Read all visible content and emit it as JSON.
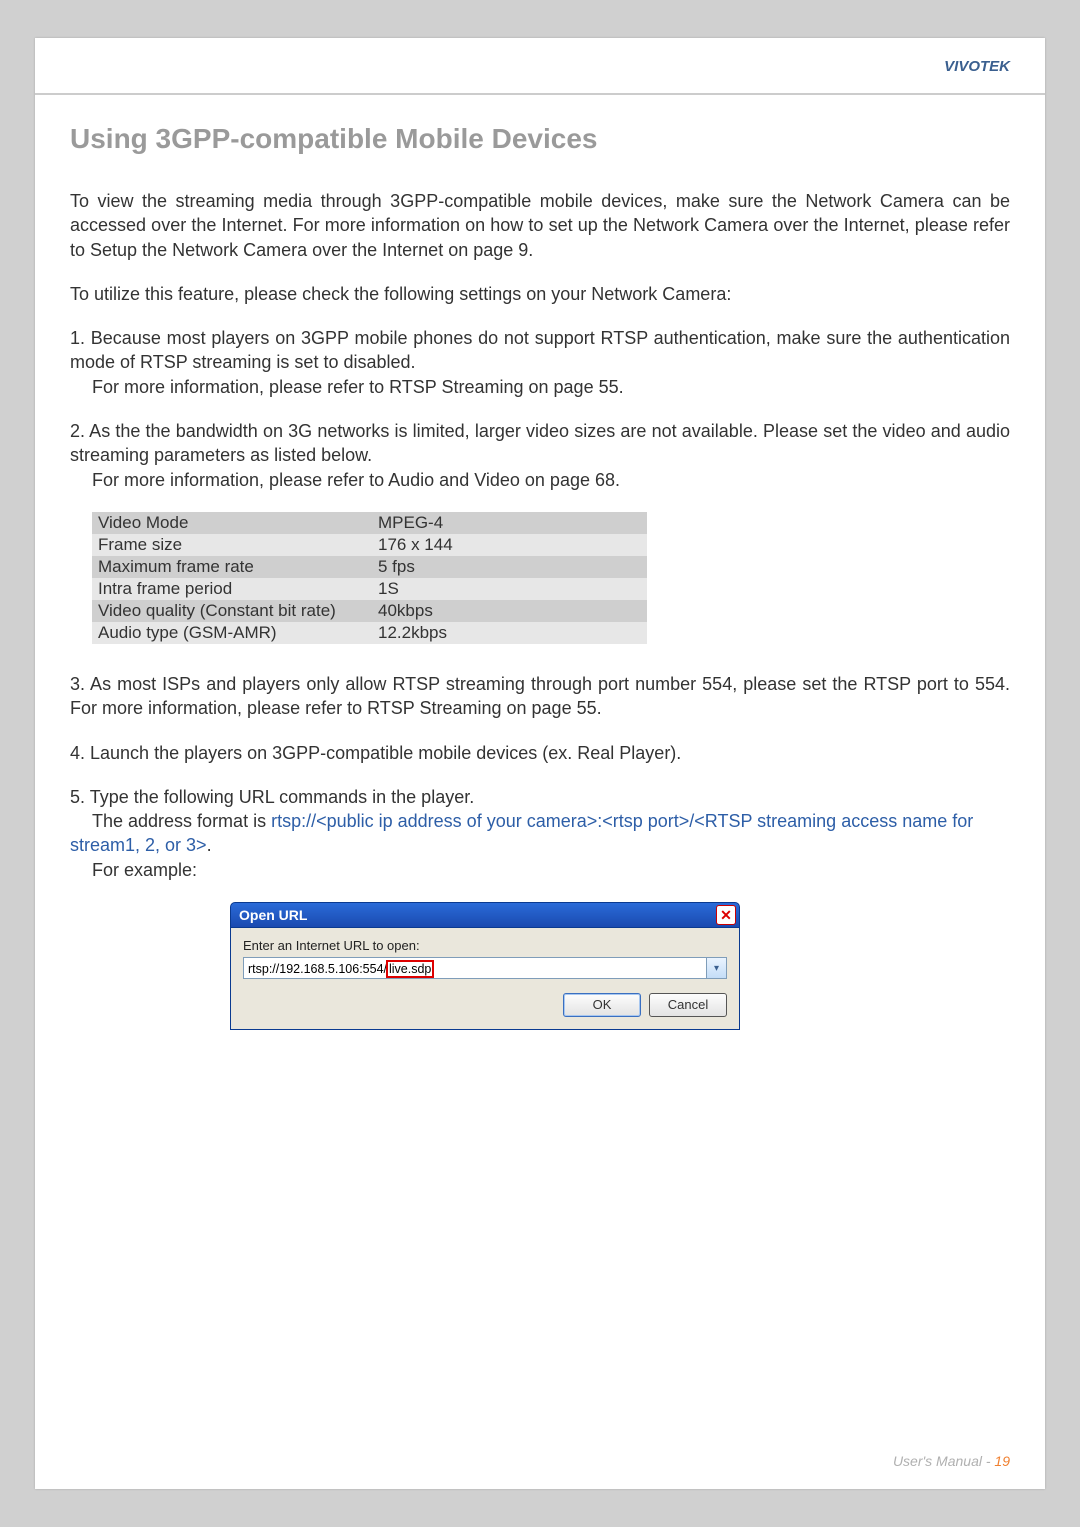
{
  "brand": "VIVOTEK",
  "section_title": "Using 3GPP-compatible Mobile Devices",
  "intro": "To view the streaming media through 3GPP-compatible mobile devices, make sure the Network Camera can be accessed over the Internet. For more information on how to set up the Network Camera over the Internet, please refer to Setup the Network Camera over the Internet on page 9.",
  "lead": "To utilize this feature, please check the following settings on your Network Camera:",
  "item1_a": "1. Because most players on 3GPP mobile phones do not support RTSP authentication, make sure the authentication mode of RTSP streaming is set to disabled.",
  "item1_b": "For more information, please refer to RTSP Streaming on page 55.",
  "item2_a": "2. As the the bandwidth on 3G networks is limited, larger video sizes are not available. Please set the video and audio streaming parameters as listed below.",
  "item2_b": "For more information, please refer to Audio and Video on page 68.",
  "settings_table": [
    {
      "label": "Video Mode",
      "value": "MPEG-4"
    },
    {
      "label": "Frame size",
      "value": "176 x 144"
    },
    {
      "label": "Maximum frame rate",
      "value": "5 fps"
    },
    {
      "label": "Intra frame period",
      "value": "1S"
    },
    {
      "label": "Video quality (Constant bit rate)",
      "value": "40kbps"
    },
    {
      "label": "Audio type (GSM-AMR)",
      "value": "12.2kbps"
    }
  ],
  "item3": "3. As most ISPs and players only allow RTSP streaming through port number 554, please set the RTSP port to 554. For more information, please refer to RTSP Streaming on page 55.",
  "item4": "4. Launch the players on 3GPP-compatible mobile devices (ex. Real Player).",
  "item5_a": "5. Type the following URL commands in the player.",
  "item5_b_pre": "The address format is ",
  "item5_b_blue": "rtsp://<public ip address of your camera>:<rtsp port>/<RTSP streaming access name for stream1, 2, or 3>",
  "item5_b_post": ".",
  "item5_c": "For example:",
  "dialog": {
    "title": "Open URL",
    "label": "Enter an Internet URL to open:",
    "url_prefix": "rtsp://192.168.5.106:554/",
    "url_highlight": "live.sdp",
    "ok": "OK",
    "cancel": "Cancel"
  },
  "footer_label": "User's Manual - ",
  "footer_page": "19"
}
